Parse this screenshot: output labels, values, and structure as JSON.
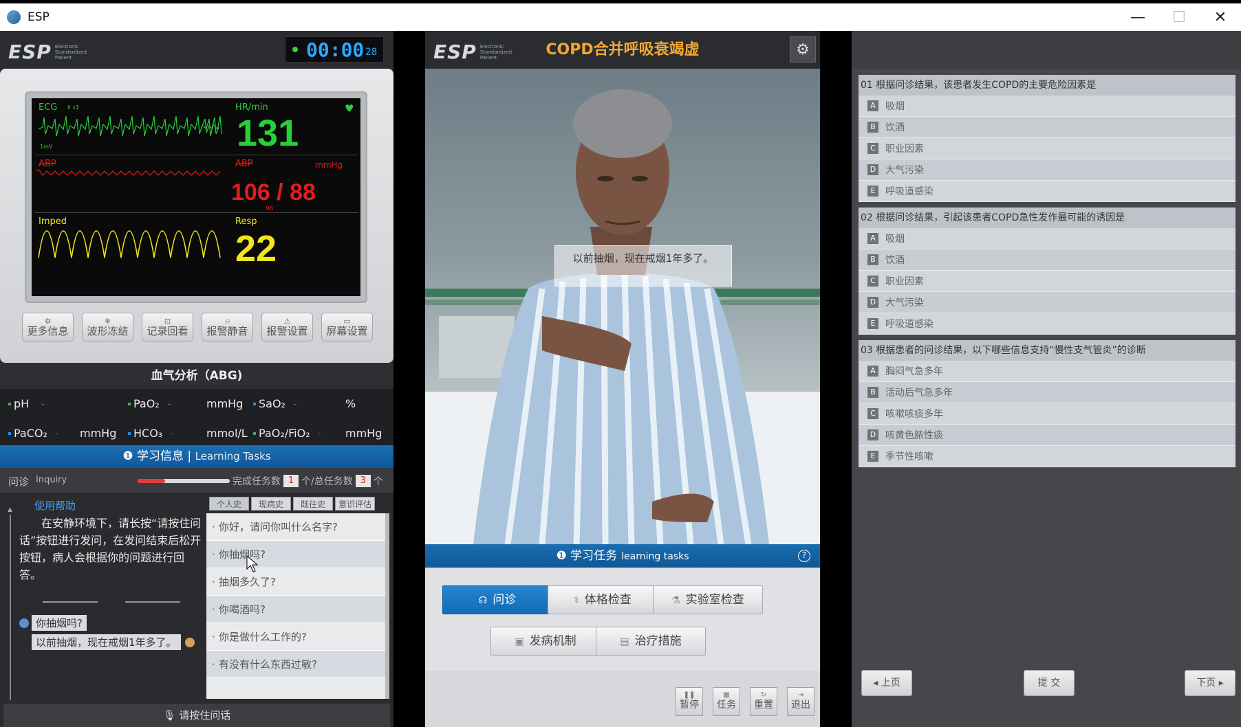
{
  "window": {
    "title": "ESP",
    "controls": [
      "—",
      "☐",
      "✕"
    ]
  },
  "left": {
    "logo": "ESP",
    "logo_sub": "Electronic Standardized Patient",
    "timer": {
      "main": "00:00",
      "sec": "28"
    },
    "monitor": {
      "ecg_label": "ECG",
      "ecg_lead": "II  x1",
      "ecg_scale": "1mV",
      "hr_label": "HR/min",
      "hr_value": "131",
      "abp_label": "ABP",
      "abp_label2": "ABP",
      "abp_unit": "mmHg",
      "abp_value": "106 / 88",
      "abp_mean": "96",
      "imped_label": "Imped",
      "resp_label": "Resp",
      "resp_value": "22",
      "colors": {
        "ecg": "#27d13a",
        "abp": "#e01e1e",
        "resp": "#f2e51a"
      }
    },
    "monitor_buttons": [
      {
        "label": "更多信息",
        "icon": "gear-icon"
      },
      {
        "label": "波形冻结",
        "icon": "snowflake-icon"
      },
      {
        "label": "记录回看",
        "icon": "record-icon"
      },
      {
        "label": "报警静音",
        "icon": "bell-mute-icon"
      },
      {
        "label": "报警设置",
        "icon": "warning-icon"
      },
      {
        "label": "屏幕设置",
        "icon": "monitor-icon"
      }
    ],
    "abg": {
      "title": "血气分析（ABG)",
      "row1": [
        {
          "name": "pH",
          "value": "-",
          "unit": ""
        },
        {
          "name": "PaO₂",
          "value": "-",
          "unit": "mmHg"
        },
        {
          "name": "SaO₂",
          "value": "-",
          "unit": "%"
        }
      ],
      "row2": [
        {
          "name": "PaCO₂",
          "value": "-",
          "unit": "mmHg"
        },
        {
          "name": "HCO₃",
          "value": "-",
          "unit": "mmol/L"
        },
        {
          "name": "PaO₂/FiO₂",
          "value": "-",
          "unit": "mmHg"
        }
      ]
    },
    "learning_bar": {
      "cn": "学习信息",
      "sep": " | ",
      "en": "Learning Tasks"
    },
    "inquiry": {
      "label_cn": "问诊",
      "label_en": "Inquiry",
      "progress": 0.3,
      "done_label": "完成任务数",
      "done": "1",
      "total_label": "个/总任务数",
      "total": "3",
      "suffix": "个"
    },
    "help": {
      "title": "使用帮助",
      "text": "在安静环境下，请长按“请按住问话”按钮进行发问，在发问结束后松开按钮，病人会根据你的问题进行回答。"
    },
    "chat": [
      {
        "role": "doctor",
        "text": "你抽烟吗?"
      },
      {
        "role": "patient",
        "text": "以前抽烟，现在戒烟1年多了。"
      }
    ],
    "question_tabs": [
      "个人史",
      "现病史",
      "既往史",
      "意识评估"
    ],
    "questions": [
      "你好，请问你叫什么名字?",
      "你抽烟吗?",
      "抽烟多久了?",
      "你喝酒吗?",
      "你是做什么工作的?",
      "有没有什么东西过敏?"
    ],
    "press_button": "请按住问话"
  },
  "middle": {
    "logo": "ESP",
    "title": "COPD合并呼吸衰竭虚",
    "speech": "以前抽烟，现在戒烟1年多了。",
    "task_bar": {
      "cn": "学习任务",
      "en": "learning tasks"
    },
    "task_buttons": [
      {
        "label": "问诊",
        "icon": "inquiry-icon",
        "active": true
      },
      {
        "label": "体格检查",
        "icon": "stethoscope-icon",
        "active": false
      },
      {
        "label": "实验室检查",
        "icon": "lab-icon",
        "active": false
      },
      {
        "label": "发病机制",
        "icon": "mechanism-icon",
        "active": false
      },
      {
        "label": "治疗措施",
        "icon": "treatment-icon",
        "active": false
      }
    ],
    "controls": [
      {
        "label": "暂停",
        "icon": "pause-icon"
      },
      {
        "label": "任务",
        "icon": "task-icon"
      },
      {
        "label": "重置",
        "icon": "reset-icon"
      },
      {
        "label": "退出",
        "icon": "exit-icon"
      }
    ]
  },
  "right": {
    "questions": [
      {
        "title": "01  根据问诊结果，该患者发生COPD的主要危险因素是",
        "options": [
          {
            "letter": "A",
            "text": "吸烟"
          },
          {
            "letter": "B",
            "text": "饮酒"
          },
          {
            "letter": "C",
            "text": "职业因素"
          },
          {
            "letter": "D",
            "text": "大气污染"
          },
          {
            "letter": "E",
            "text": "呼吸道感染"
          }
        ]
      },
      {
        "title": "02  根据问诊结果，引起该患者COPD急性发作最可能的诱因是",
        "options": [
          {
            "letter": "A",
            "text": "吸烟"
          },
          {
            "letter": "B",
            "text": "饮酒"
          },
          {
            "letter": "C",
            "text": "职业因素"
          },
          {
            "letter": "D",
            "text": "大气污染"
          },
          {
            "letter": "E",
            "text": "呼吸道感染"
          }
        ]
      },
      {
        "title": "03  根据患者的问诊结果，以下哪些信息支持“慢性支气管炎”的诊断",
        "options": [
          {
            "letter": "A",
            "text": "胸闷气急多年"
          },
          {
            "letter": "B",
            "text": "活动后气急多年"
          },
          {
            "letter": "C",
            "text": "咳嗽咳痰多年"
          },
          {
            "letter": "D",
            "text": "咳黄色脓性痰"
          },
          {
            "letter": "E",
            "text": "季节性咳嗽"
          }
        ]
      }
    ],
    "nav": {
      "prev": "◂ 上页",
      "submit": "提 交",
      "next": "下页 ▸"
    }
  }
}
